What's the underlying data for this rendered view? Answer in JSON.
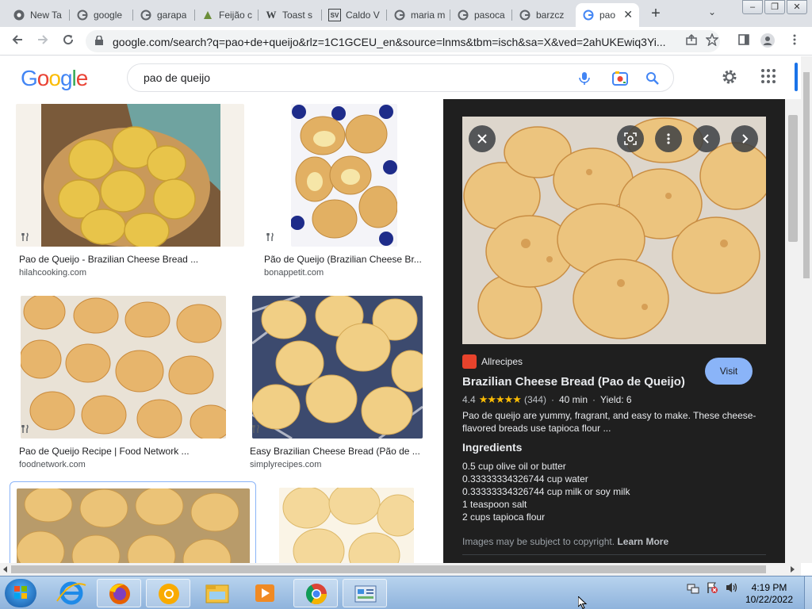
{
  "browser": {
    "tabs": [
      {
        "label": "New Ta",
        "favicon": "chrome-icon"
      },
      {
        "label": "google",
        "favicon": "google-icon"
      },
      {
        "label": "garapa",
        "favicon": "google-icon"
      },
      {
        "label": "Feijão c",
        "favicon": "leaf-icon"
      },
      {
        "label": "Toast s",
        "favicon": "wikipedia-icon"
      },
      {
        "label": "Caldo V",
        "favicon": "sv-icon"
      },
      {
        "label": "maria m",
        "favicon": "google-icon"
      },
      {
        "label": "pasoca",
        "favicon": "google-icon"
      },
      {
        "label": "barzcz",
        "favicon": "google-icon"
      },
      {
        "label": "pao",
        "favicon": "google-icon"
      }
    ],
    "wiki_glyph": "W",
    "sv_glyph": "SV",
    "new_tab_glyph": "+",
    "close_glyph": "✕",
    "tab_search_glyph": "⌄",
    "window_buttons": [
      "–",
      "❐",
      "✕"
    ],
    "url": "google.com/search?q=pao+de+queijo&rlz=1C1GCEU_en&source=lnms&tbm=isch&sa=X&ved=2ahUKEwiq3Yi..."
  },
  "google": {
    "logo": "Google",
    "query": "pao de queijo"
  },
  "results": [
    {
      "title": "Pao de Queijo - Brazilian Cheese Bread ...",
      "source": "hilahcooking.com"
    },
    {
      "title": "Pão de Queijo (Brazilian Cheese Br...",
      "source": "bonappetit.com"
    },
    {
      "title": "Pao de Queijo Recipe | Food Network ...",
      "source": "foodnetwork.com"
    },
    {
      "title": "Easy Brazilian Cheese Bread (Pão de ...",
      "source": "simplyrecipes.com"
    }
  ],
  "preview": {
    "source": "Allrecipes",
    "title": "Brazilian Cheese Bread (Pao de Queijo)",
    "visit": "Visit",
    "rating": "4.4",
    "stars": "★★★★★",
    "reviews": "(344)",
    "time": "40 min",
    "yield": "Yield: 6",
    "separator": "·",
    "description": "Pao de queijo are yummy, fragrant, and easy to make. These cheese-flavored breads use tapioca flour ...",
    "ingredients_heading": "Ingredients",
    "ingredients": [
      "0.5 cup olive oil or butter",
      "0.33333334326744 cup water",
      "0.33333334326744 cup milk or soy milk",
      "1 teaspoon salt",
      "2 cups tapioca flour"
    ],
    "copyright": "Images may be subject to copyright.",
    "learn_more": "Learn More"
  },
  "taskbar": {
    "time": "4:19 PM",
    "date": "10/22/2022"
  },
  "colors": {
    "accent": "#8ab4f8",
    "panel_bg": "#1f1f1f",
    "star": "#fbbc04"
  }
}
